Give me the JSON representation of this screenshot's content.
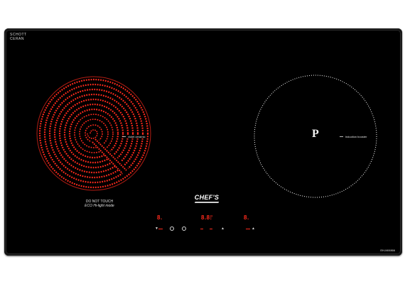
{
  "brand": {
    "line1": "SCHOTT",
    "line2": "CERAN"
  },
  "left_zone": {
    "label": "violet ceramic",
    "warning_line1": "DO NOT TOUCH",
    "warning_line2": "ECO Hi-light mode"
  },
  "right_zone": {
    "label": "induction booster",
    "symbol": "P"
  },
  "logo": {
    "text": "CHEF'S"
  },
  "controls": {
    "left_level": "8.",
    "center_timer": "8.8.",
    "center_sub": "P",
    "right_level": "8.",
    "small_mark": "▲",
    "down_mark": "▼"
  },
  "model": "EH-MIX866",
  "colors": {
    "glass": "#000000",
    "heating": "#ff2a1c",
    "print": "#e0e0e0"
  }
}
